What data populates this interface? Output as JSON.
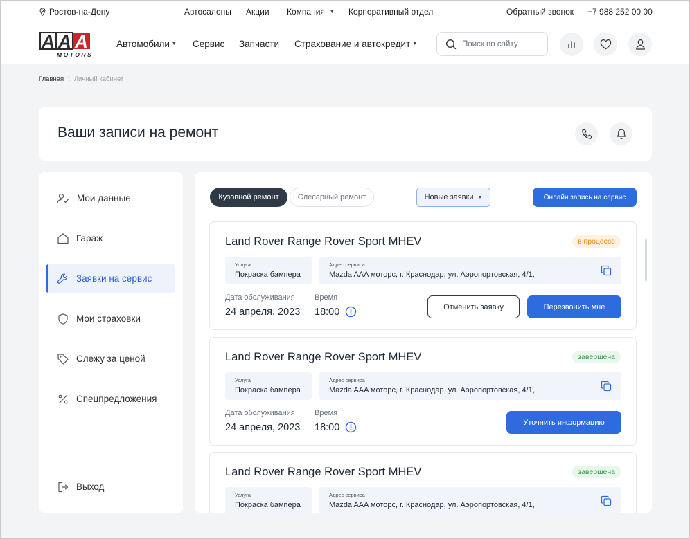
{
  "topbar": {
    "city": "Ростов-на-Дону",
    "links": [
      "Автосалоны",
      "Акции",
      "Компания",
      "Корпоративный отдел"
    ],
    "callback": "Обратный звонок",
    "phone": "+7 988 252 00 00"
  },
  "header": {
    "logo_text": "AAA",
    "logo_sub": "MOTORS",
    "nav": [
      "Автомобили",
      "Сервис",
      "Запчасти",
      "Страхование и автокредит"
    ],
    "search_placeholder": "Поиск по сайту"
  },
  "breadcrumb": {
    "home": "Главная",
    "current": "Личный кабинет"
  },
  "page": {
    "title": "Ваши записи на ремонт"
  },
  "sidebar": {
    "items": [
      {
        "label": "Мои данные",
        "icon": "user-check-icon"
      },
      {
        "label": "Гараж",
        "icon": "home-icon"
      },
      {
        "label": "Заявки на сервис",
        "icon": "wrench-icon",
        "active": true
      },
      {
        "label": "Мои страховки",
        "icon": "shield-icon"
      },
      {
        "label": "Слежу за ценой",
        "icon": "tag-icon"
      },
      {
        "label": "Спецпредложения",
        "icon": "percent-icon"
      }
    ],
    "logout": "Выход"
  },
  "filters": {
    "tab_body": "Кузовной ремонт",
    "tab_mech": "Слесарный ремонт",
    "dropdown": "Новые заявки",
    "online_button": "Онлайн запись на сервис"
  },
  "requests": [
    {
      "car": "Land Rover Range Rover Sport MHEV",
      "status": "в процессе",
      "service_label": "Услуга",
      "service": "Покраска бампера",
      "address_label": "Адрес сервиса",
      "address": "Mazda AAA моторс,  г. Краснодар, ул. Аэропортовская, 4/1,",
      "date_label": "Дата обслуживания",
      "date": "24 апреля, 2023",
      "time_label": "Время",
      "time": "18:00",
      "cancel": "Отменить заявку",
      "callback": "Перезвонить мне"
    },
    {
      "car": "Land Rover Range Rover Sport MHEV",
      "status": "завершена",
      "service_label": "Услуга",
      "service": "Покраска бампера",
      "address_label": "Адрес сервиса",
      "address": "Mazda AAA моторс,  г. Краснодар, ул. Аэропортовская, 4/1,",
      "date_label": "Дата обслуживания",
      "date": "24 апреля, 2023",
      "time_label": "Время",
      "time": "18:00",
      "clarify": "Уточнить информацию"
    },
    {
      "car": "Land Rover Range Rover Sport MHEV",
      "status": "завершена",
      "service_label": "Услуга",
      "service": "Покраска бампера",
      "address_label": "Адрес сервиса",
      "address": "Mazda AAA моторс,  г. Краснодар, ул. Аэропортовская, 4/1,"
    }
  ],
  "colors": {
    "accent": "#2e6bdf",
    "dark_pill": "#2f3a46",
    "in_progress": "#e38a1d",
    "done": "#3a9a4f",
    "logo_red": "#c8252c"
  }
}
